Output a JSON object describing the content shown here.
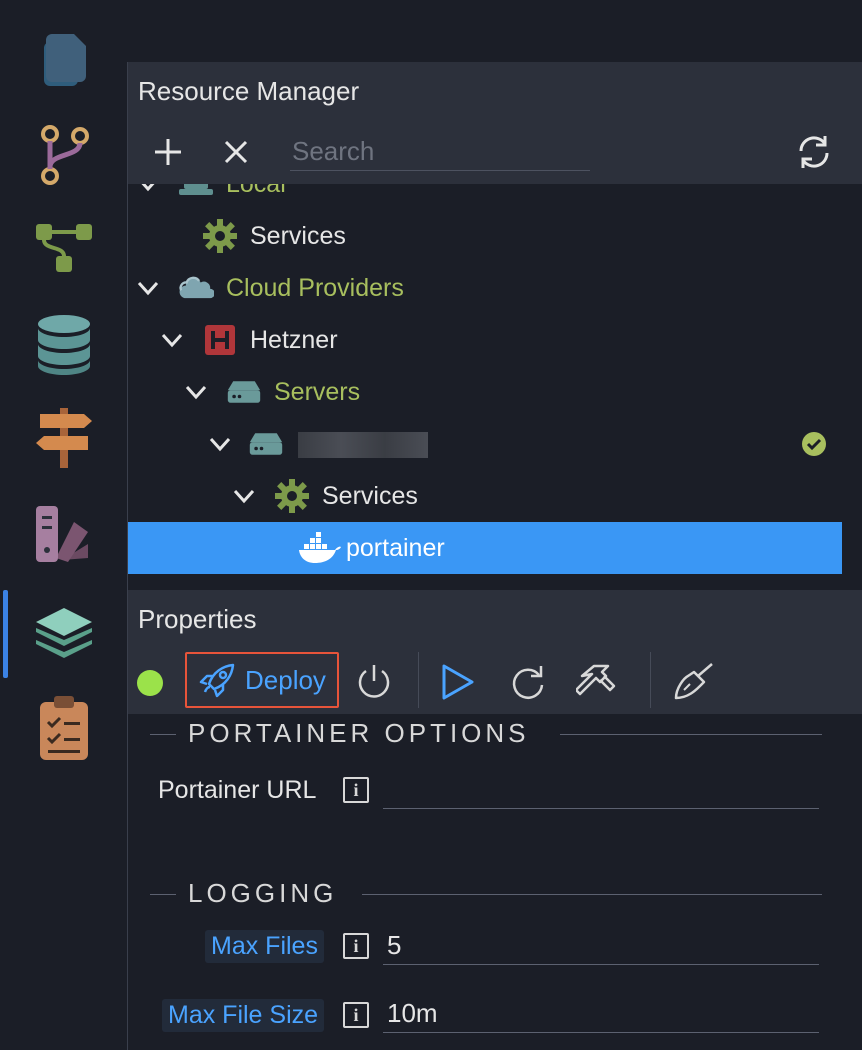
{
  "resource_manager": {
    "title": "Resource Manager",
    "search_placeholder": "Search",
    "tree": [
      {
        "label": "Local"
      },
      {
        "label": "Services"
      },
      {
        "label": "Cloud Providers"
      },
      {
        "label": "Hetzner"
      },
      {
        "label": "Servers"
      },
      {
        "label": ""
      },
      {
        "label": "Services"
      },
      {
        "label": "portainer"
      }
    ]
  },
  "properties": {
    "title": "Properties",
    "deploy_label": "Deploy",
    "sections": [
      {
        "title": "PORTAINER OPTIONS",
        "fields": [
          {
            "label": "Portainer URL",
            "value": ""
          }
        ]
      },
      {
        "title": "LOGGING",
        "fields": [
          {
            "label": "Max Files",
            "value": "5"
          },
          {
            "label": "Max File Size",
            "value": "10m"
          }
        ]
      }
    ]
  },
  "colors": {
    "accent": "#3a97f5",
    "tree_green": "#a8bf5e",
    "status_ok": "#9be24a",
    "deploy_outline": "#e8543a"
  }
}
